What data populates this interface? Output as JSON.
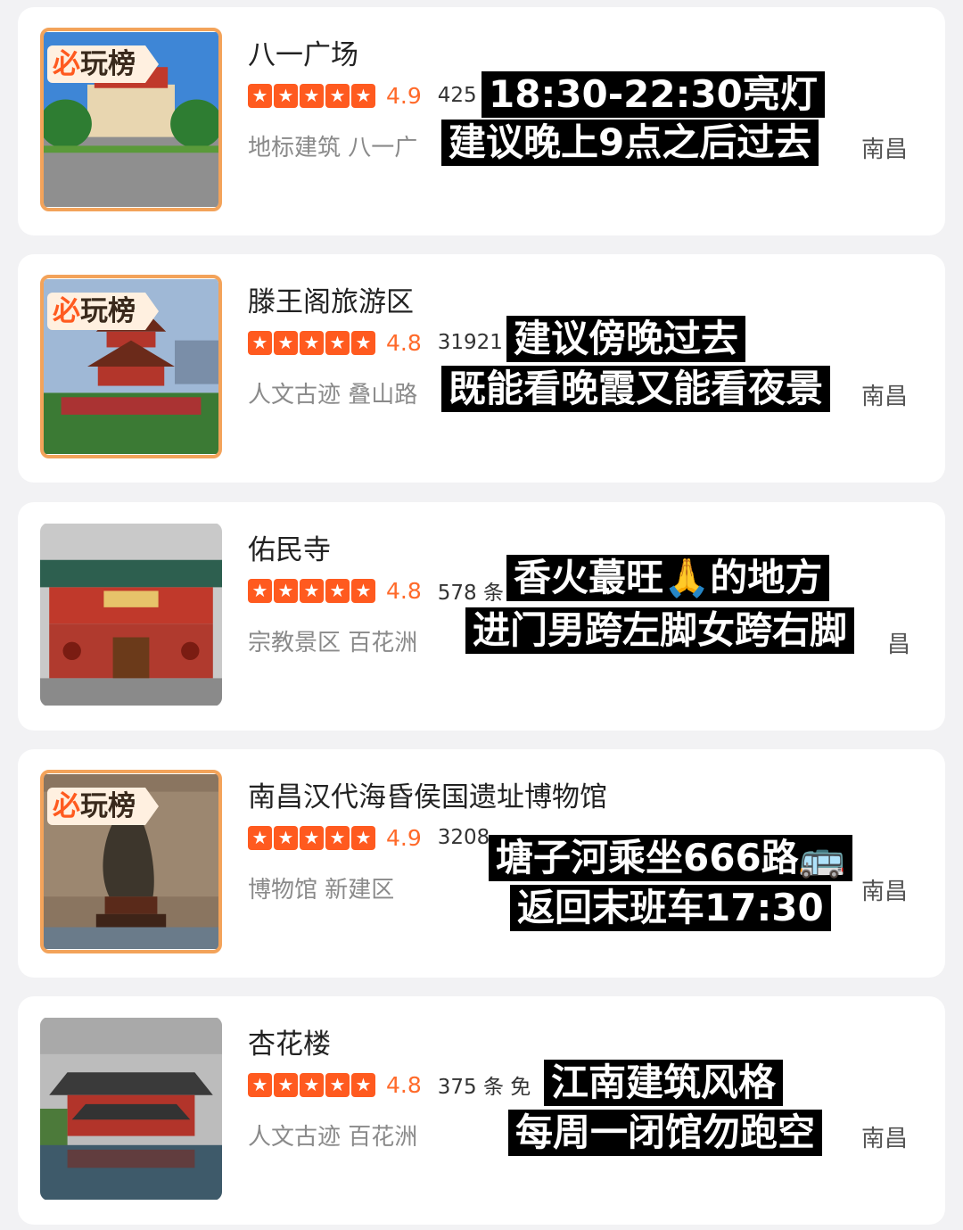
{
  "badge": {
    "mark": "必",
    "text": "玩榜"
  },
  "cards": [
    {
      "title": "八一广场",
      "score": "4.9",
      "count": "425",
      "meta": "地标建筑 八一广",
      "city": "南昌",
      "captions": [
        "18:30-22:30亮灯",
        "建议晚上9点之后过去"
      ],
      "has_badge": true
    },
    {
      "title": "滕王阁旅游区",
      "score": "4.8",
      "count": "31921",
      "meta": "人文古迹 叠山路",
      "city": "南昌",
      "captions": [
        "建议傍晚过去",
        "既能看晚霞又能看夜景"
      ],
      "has_badge": true
    },
    {
      "title": "佑民寺",
      "score": "4.8",
      "count": "578 条",
      "meta": "宗教景区 百花洲",
      "city": "昌",
      "captions": [
        "香火蕞旺🙏的地方",
        "进门男跨左脚女跨右脚"
      ],
      "has_badge": false
    },
    {
      "title": "南昌汉代海昏侯国遗址博物馆",
      "score": "4.9",
      "count": "3208",
      "meta": "博物馆 新建区",
      "city": "南昌",
      "captions": [
        "塘子河乘坐666路🚌",
        "返回末班车17:30"
      ],
      "has_badge": true
    },
    {
      "title": "杏花楼",
      "score": "4.8",
      "count": "375 条  免",
      "meta": "人文古迹 百花洲",
      "city": "南昌",
      "captions": [
        "江南建筑风格",
        "每周一闭馆勿跑空"
      ],
      "has_badge": false
    }
  ]
}
